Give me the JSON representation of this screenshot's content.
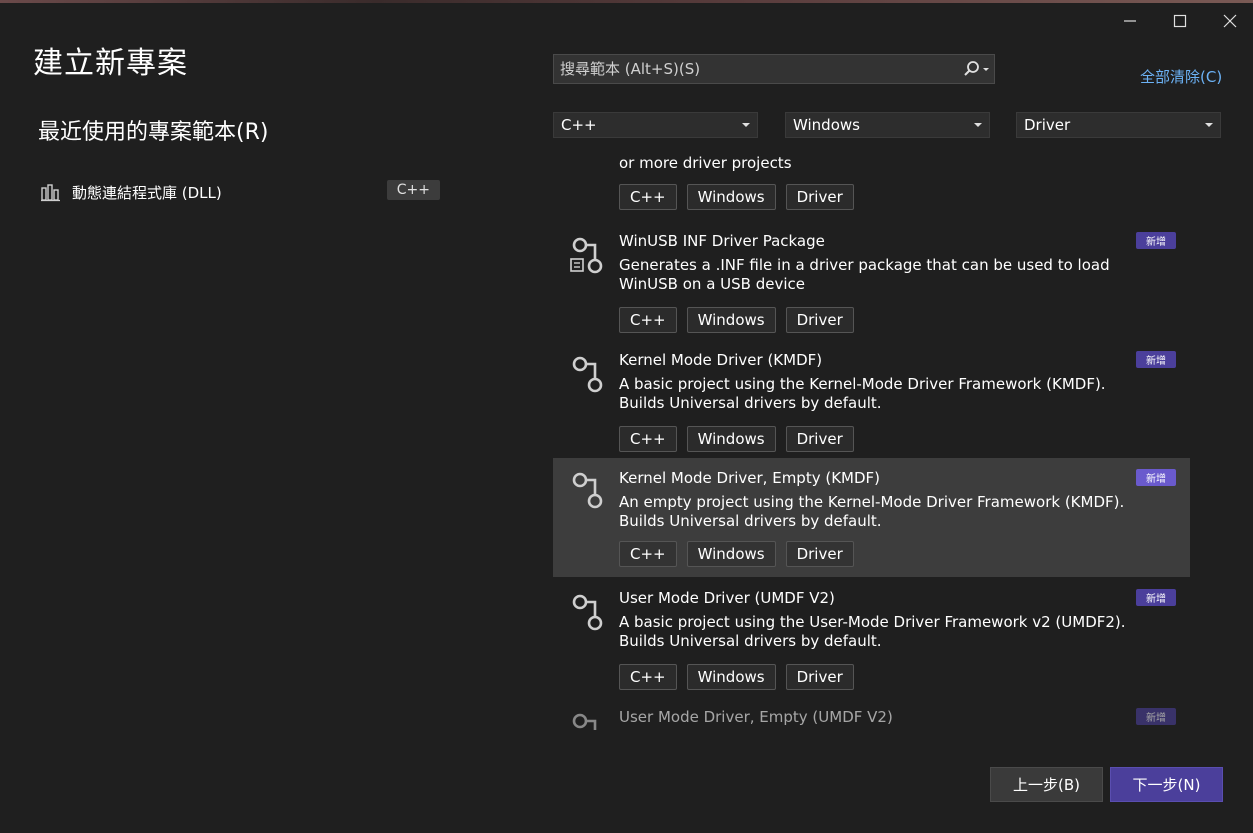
{
  "window": {
    "title": "建立新專案",
    "controls": {
      "minimize": "minimize-icon",
      "maximize": "maximize-icon",
      "close": "close-icon"
    }
  },
  "recent": {
    "heading": "最近使用的專案範本(R)",
    "items": [
      {
        "label": "動態連結程式庫 (DLL)",
        "tag": "C++",
        "icon": "dll-icon"
      }
    ]
  },
  "search": {
    "placeholder": "搜尋範本 (Alt+S)(S)",
    "value": ""
  },
  "clear_all": "全部清除(C)",
  "filters": {
    "language": "C++",
    "platform": "Windows",
    "project_type": "Driver"
  },
  "templates": {
    "partial_top": {
      "desc_tail": "or more driver projects",
      "tags": [
        "C++",
        "Windows",
        "Driver"
      ]
    },
    "items": [
      {
        "name": "WinUSB INF Driver Package",
        "desc": "Generates a .INF file in a driver package that can be used to load WinUSB on a USB device",
        "badge": "新增",
        "tags": [
          "C++",
          "Windows",
          "Driver"
        ]
      },
      {
        "name": "Kernel Mode Driver (KMDF)",
        "desc": "A basic project using the Kernel-Mode Driver Framework (KMDF). Builds Universal drivers by default.",
        "badge": "新增",
        "tags": [
          "C++",
          "Windows",
          "Driver"
        ]
      },
      {
        "name": "Kernel Mode Driver, Empty (KMDF)",
        "desc": "An empty project using the Kernel-Mode Driver Framework (KMDF). Builds Universal drivers by default.",
        "badge": "新增",
        "tags": [
          "C++",
          "Windows",
          "Driver"
        ]
      },
      {
        "name": "User Mode Driver (UMDF V2)",
        "desc": "A basic project using the User-Mode Driver Framework v2 (UMDF2). Builds Universal drivers by default.",
        "badge": "新增",
        "tags": [
          "C++",
          "Windows",
          "Driver"
        ]
      },
      {
        "name": "User Mode Driver, Empty (UMDF V2)",
        "desc": "",
        "badge": "新增",
        "tags": []
      }
    ]
  },
  "buttons": {
    "back": "上一步(B)",
    "next": "下一步(N)"
  },
  "colors": {
    "background": "#1f1f1f",
    "accent": "#4b3f9b",
    "link": "#6cb2f5",
    "selected_row": "#3d3d3d"
  }
}
